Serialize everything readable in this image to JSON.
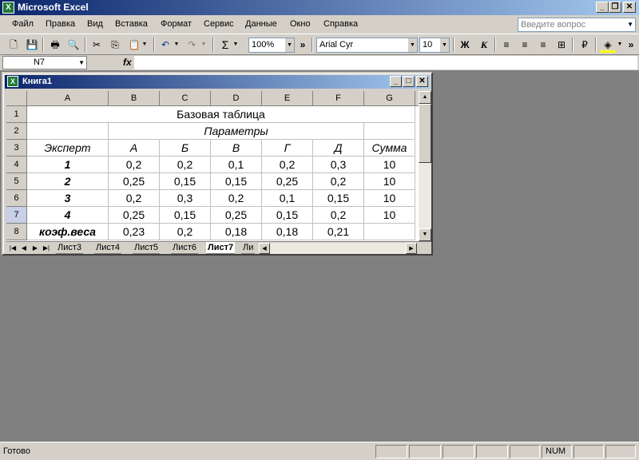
{
  "app": {
    "title": "Microsoft Excel",
    "icon": "X"
  },
  "menu": {
    "items": [
      "Файл",
      "Правка",
      "Вид",
      "Вставка",
      "Формат",
      "Сервис",
      "Данные",
      "Окно",
      "Справка"
    ],
    "help_placeholder": "Введите вопрос"
  },
  "toolbar": {
    "zoom": "100%",
    "font": "Arial Cyr",
    "font_size": "10",
    "bold": "Ж",
    "more": "»"
  },
  "formula": {
    "cell_ref": "N7",
    "fx": "fx",
    "value": ""
  },
  "workbook": {
    "title": "Книга1",
    "columns": [
      "A",
      "B",
      "C",
      "D",
      "E",
      "F",
      "G"
    ],
    "rows": [
      "1",
      "2",
      "3",
      "4",
      "5",
      "6",
      "7",
      "8"
    ],
    "table_title": "Базовая таблица",
    "params_header": "Параметры",
    "expert_header": "Эксперт",
    "param_headers": [
      "А",
      "Б",
      "В",
      "Г",
      "Д"
    ],
    "sum_header": "Сумма",
    "data_rows": [
      {
        "expert": "1",
        "values": [
          "0,2",
          "0,2",
          "0,1",
          "0,2",
          "0,3"
        ],
        "sum": "10"
      },
      {
        "expert": "2",
        "values": [
          "0,25",
          "0,15",
          "0,15",
          "0,25",
          "0,2"
        ],
        "sum": "10"
      },
      {
        "expert": "3",
        "values": [
          "0,2",
          "0,3",
          "0,2",
          "0,1",
          "0,15"
        ],
        "sum": "10"
      },
      {
        "expert": "4",
        "values": [
          "0,25",
          "0,15",
          "0,25",
          "0,15",
          "0,2"
        ],
        "sum": "10"
      }
    ],
    "weights_row": {
      "label": "коэф.веса",
      "values": [
        "0,23",
        "0,2",
        "0,18",
        "0,18",
        "0,21"
      ]
    },
    "sheets": [
      "Лист3",
      "Лист4",
      "Лист5",
      "Лист6",
      "Лист7",
      "Ли"
    ],
    "active_sheet": "Лист7"
  },
  "status": {
    "text": "Готово",
    "num": "NUM"
  }
}
